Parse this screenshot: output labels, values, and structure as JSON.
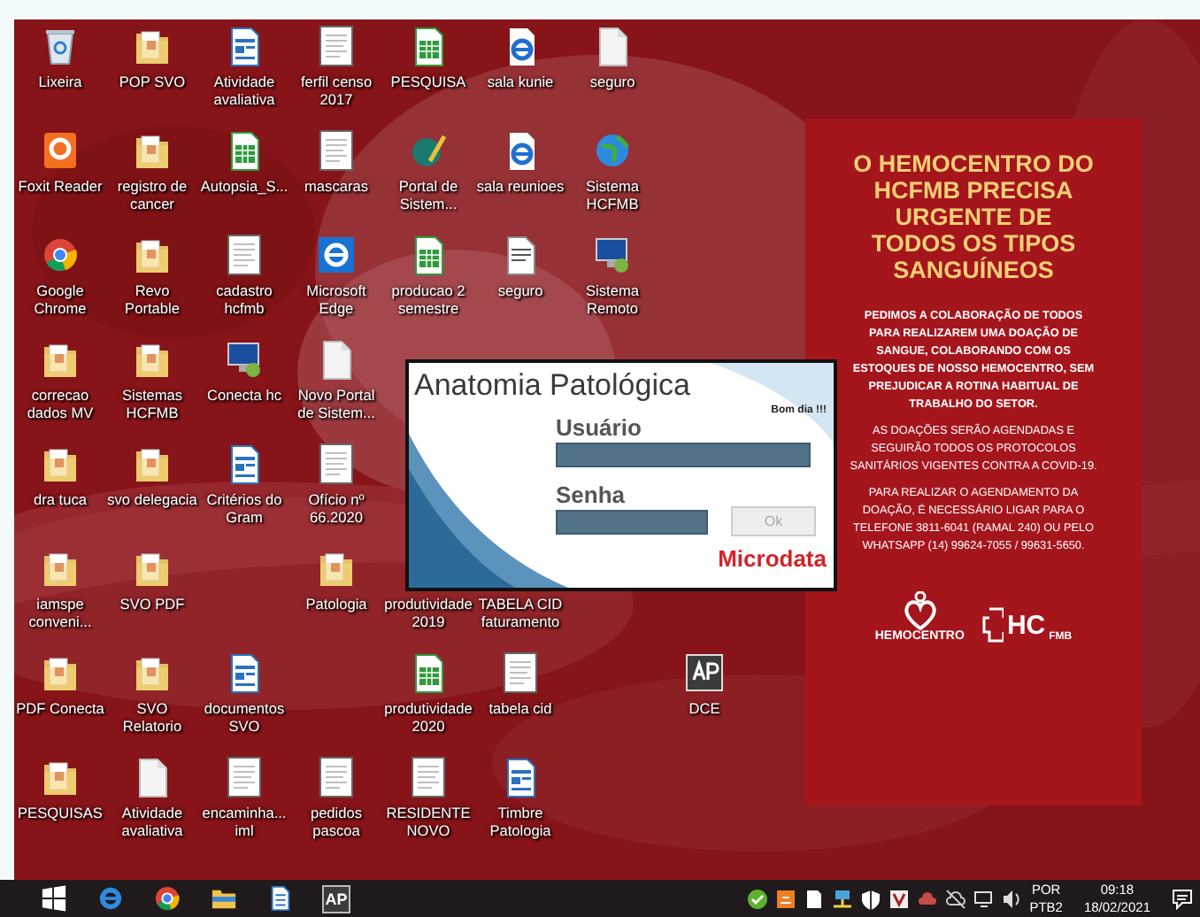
{
  "desktop": {
    "rows": [
      {
        "icons": [
          {
            "label": "Lixeira",
            "kind": "recycle"
          },
          {
            "label": "POP SVO",
            "kind": "folder"
          },
          {
            "label": "Atividade avaliativa",
            "kind": "writer"
          },
          {
            "label": "ferfil censo 2017",
            "kind": "page"
          },
          {
            "label": "PESQUISA",
            "kind": "calc"
          },
          {
            "label": "sala kunie",
            "kind": "ie"
          },
          {
            "label": "seguro",
            "kind": "blank"
          }
        ]
      },
      {
        "icons": [
          {
            "label": "Foxit Reader",
            "kind": "foxit"
          },
          {
            "label": "registro de cancer",
            "kind": "folder"
          },
          {
            "label": "Autopsia_S...",
            "kind": "calc"
          },
          {
            "label": "mascaras",
            "kind": "page"
          },
          {
            "label": "Portal de Sistem...",
            "kind": "portal"
          },
          {
            "label": "sala reunioes",
            "kind": "ie"
          },
          {
            "label": "Sistema HCFMB",
            "kind": "globe"
          }
        ]
      },
      {
        "icons": [
          {
            "label": "Google Chrome",
            "kind": "chrome"
          },
          {
            "label": "Revo Portable",
            "kind": "folder"
          },
          {
            "label": "cadastro hcfmb",
            "kind": "page"
          },
          {
            "label": "Microsoft Edge",
            "kind": "edge"
          },
          {
            "label": "producao 2 semestre",
            "kind": "calc"
          },
          {
            "label": "seguro",
            "kind": "doc"
          },
          {
            "label": "Sistema Remoto",
            "kind": "monitor"
          }
        ]
      },
      {
        "icons": [
          {
            "label": "correcao dados MV",
            "kind": "folder"
          },
          {
            "label": "Sistemas HCFMB",
            "kind": "folder"
          },
          {
            "label": "Conecta hc",
            "kind": "monitor"
          },
          {
            "label": "Novo Portal de Sistem...",
            "kind": "blank"
          }
        ]
      },
      {
        "icons": [
          {
            "label": "dra tuca",
            "kind": "folder"
          },
          {
            "label": "svo delegacia",
            "kind": "folder"
          },
          {
            "label": "Critérios do Gram",
            "kind": "writer"
          },
          {
            "label": "Ofício nº 66.2020",
            "kind": "page"
          }
        ]
      },
      {
        "icons": [
          {
            "label": "iamspe conveni...",
            "kind": "folder"
          },
          {
            "label": "SVO PDF",
            "kind": "folder"
          },
          {
            "kind": "none"
          },
          {
            "label": "Patologia",
            "kind": "folder"
          },
          {
            "label": "produtividade 2019",
            "kind": "none-label"
          },
          {
            "label": "TABELA CID faturamento",
            "kind": "none-label"
          }
        ]
      },
      {
        "icons": [
          {
            "label": "PDF Conecta",
            "kind": "folder"
          },
          {
            "label": "SVO Relatorio",
            "kind": "folder"
          },
          {
            "label": "documentos SVO",
            "kind": "writer"
          },
          {
            "kind": "none"
          },
          {
            "label": "produtividade 2020",
            "kind": "calc"
          },
          {
            "label": "tabela cid",
            "kind": "page"
          },
          {
            "kind": "none"
          },
          {
            "label": "DCE",
            "kind": "ap"
          }
        ]
      },
      {
        "icons": [
          {
            "label": "PESQUISAS",
            "kind": "folder"
          },
          {
            "label": "Atividade avaliativa",
            "kind": "blank"
          },
          {
            "label": "encaminha... iml",
            "kind": "page"
          },
          {
            "label": "pedidos pascoa",
            "kind": "page"
          },
          {
            "label": "RESIDENTE NOVO",
            "kind": "page"
          },
          {
            "label": "Timbre Patologia",
            "kind": "writer"
          }
        ]
      }
    ]
  },
  "login": {
    "title": "Anatomia Patológica",
    "greeting": "Bom dia !!!",
    "user_label": "Usuário",
    "password_label": "Senha",
    "ok_button": "Ok",
    "ok_disabled": true,
    "brand": "Microdata"
  },
  "poster": {
    "headline": "O HEMOCENTRO DO HCFMB PRECISA URGENTE DE TODOS OS TIPOS SANGUÍNEOS",
    "paragraphs": [
      {
        "text": "PEDIMOS A COLABORAÇÃO DE TODOS PARA REALIZAREM UMA DOAÇÃO DE SANGUE, COLABORANDO COM OS ESTOQUES DE NOSSO HEMOCENTRO, SEM PREJUDICAR A ROTINA HABITUAL DE TRABALHO DO SETOR.",
        "kind": "bold"
      },
      {
        "text": "AS DOAÇÕES SERÃO AGENDADAS E SEGUIRÃO TODOS OS PROTOCOLOS SANITÁRIOS VIGENTES CONTRA A COVID-19.",
        "kind": "plain"
      },
      {
        "text": "PARA REALIZAR O AGENDAMENTO DA DOAÇÃO, É NECESSÁRIO LIGAR PARA O TELEFONE 3811-6041 (RAMAL 240) OU PELO WHATSAPP (14) 99624-7055 / 99631-5650.",
        "kind": "plain"
      }
    ],
    "logo_left": "HEMOCENTRO",
    "logo_right_top": "HC",
    "logo_right_bottom": "FMB"
  },
  "taskbar": {
    "apps": [
      {
        "kind": "start"
      },
      {
        "kind": "edge"
      },
      {
        "kind": "chrome"
      },
      {
        "kind": "explorer"
      },
      {
        "kind": "writer"
      },
      {
        "kind": "ap",
        "label": "AP"
      }
    ],
    "tray": [
      {
        "kind": "shield"
      },
      {
        "kind": "orange"
      },
      {
        "kind": "page"
      },
      {
        "kind": "network"
      },
      {
        "kind": "security"
      },
      {
        "kind": "app"
      },
      {
        "kind": "cloud"
      },
      {
        "kind": "cloudoff"
      },
      {
        "kind": "display"
      },
      {
        "kind": "volume"
      }
    ],
    "language": "POR",
    "layout": "PTB2",
    "time": "09:18",
    "date": "18/02/2021"
  }
}
